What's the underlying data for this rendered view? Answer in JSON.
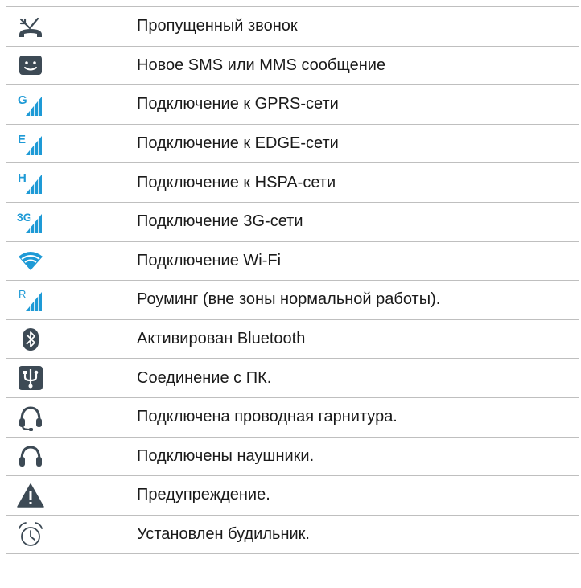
{
  "rows": [
    {
      "icon": "missed-call-icon",
      "label": "Пропущенный звонок"
    },
    {
      "icon": "sms-icon",
      "label": "Новое SMS или MMS сообщение"
    },
    {
      "icon": "gprs-signal-icon",
      "label": "Подключение к GPRS-сети",
      "letter": "G"
    },
    {
      "icon": "edge-signal-icon",
      "label": "Подключение к EDGE-сети",
      "letter": "E"
    },
    {
      "icon": "hspa-signal-icon",
      "label": "Подключение к HSPA-сети",
      "letter": "H"
    },
    {
      "icon": "3g-signal-icon",
      "label": "Подключение 3G-сети",
      "letter": "3G"
    },
    {
      "icon": "wifi-icon",
      "label": "Подключение Wi-Fi"
    },
    {
      "icon": "roaming-icon",
      "label": "Роуминг (вне зоны нормальной работы).",
      "letter": "R"
    },
    {
      "icon": "bluetooth-icon",
      "label": "Активирован Bluetooth"
    },
    {
      "icon": "usb-icon",
      "label": "Соединение с ПК."
    },
    {
      "icon": "wired-headset-icon",
      "label": "Подключена проводная гарнитура."
    },
    {
      "icon": "headphones-icon",
      "label": "Подключены наушники."
    },
    {
      "icon": "warning-icon",
      "label": "Предупреждение."
    },
    {
      "icon": "alarm-icon",
      "label": "Установлен будильник."
    }
  ],
  "colors": {
    "icon_dark": "#3d4a55",
    "signal_blue": "#1e9ad6",
    "border": "#bfbfbf"
  }
}
